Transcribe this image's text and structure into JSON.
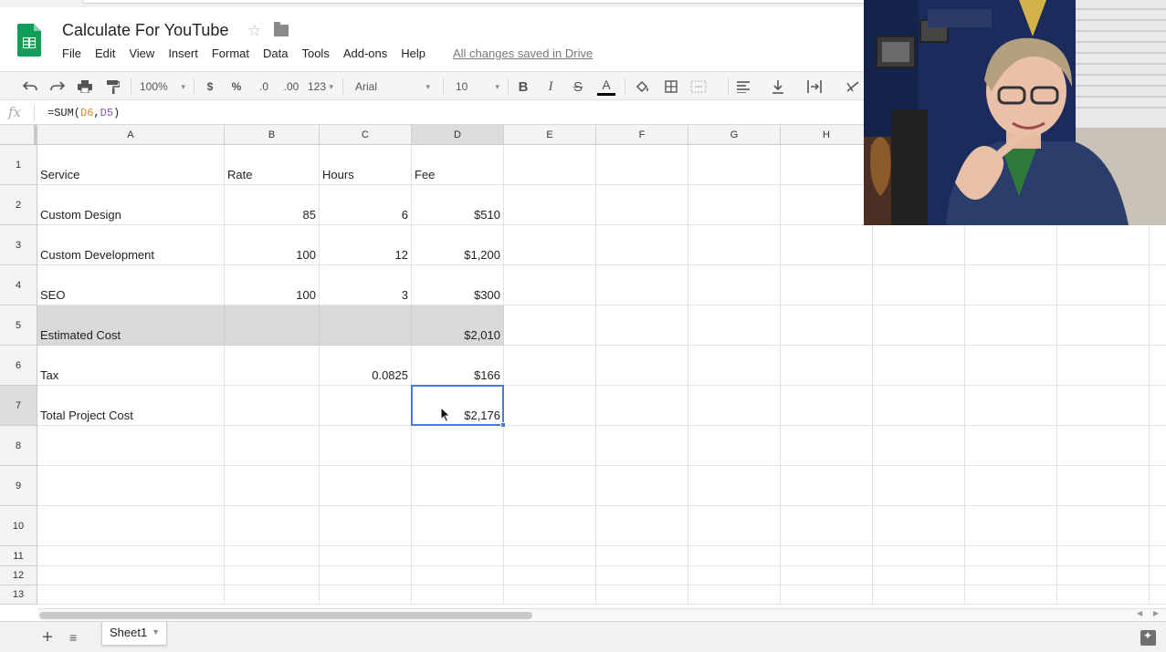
{
  "doc": {
    "title": "Calculate For YouTube",
    "saved_status": "All changes saved in Drive"
  },
  "menu": [
    "File",
    "Edit",
    "View",
    "Insert",
    "Format",
    "Data",
    "Tools",
    "Add-ons",
    "Help"
  ],
  "toolbar": {
    "zoom": "100%",
    "currency": "$",
    "percent": "%",
    "decrease_decimals": ".0",
    "increase_decimals": ".00",
    "more_formats": "123",
    "font": "Arial",
    "font_size": "10",
    "bold": "B",
    "italic": "I",
    "strikethrough": "S",
    "text_color": "A",
    "text_color_hex": "#000000"
  },
  "formula_bar": {
    "fx": "fx",
    "prefix": "=SUM(",
    "ref1": "D6",
    "comma": ",",
    "ref2": "D5",
    "suffix": ")"
  },
  "columns": [
    "A",
    "B",
    "C",
    "D",
    "E",
    "F",
    "G",
    "H",
    "",
    "",
    "",
    ""
  ],
  "rows": [
    "1",
    "2",
    "3",
    "4",
    "5",
    "6",
    "7",
    "8",
    "9",
    "10",
    "11",
    "12",
    "13"
  ],
  "cells": {
    "A1": "Service",
    "B1": "Rate",
    "C1": "Hours",
    "D1": "Fee",
    "A2": "Custom Design",
    "B2": "85",
    "C2": "6",
    "D2": "$510",
    "A3": "Custom Development",
    "B3": "100",
    "C3": "12",
    "D3": "$1,200",
    "A4": "SEO",
    "B4": "100",
    "C4": "3",
    "D4": "$300",
    "A5": "Estimated Cost",
    "D5": "$2,010",
    "C6": "0.0825",
    "A6": "Tax",
    "D6": "$166",
    "A7": "Total Project Cost",
    "D7": "$2,176"
  },
  "selection": {
    "cell": "D7",
    "column": "D",
    "row": "7",
    "color": "#4a7bd6"
  },
  "shaded_row": {
    "row": "5",
    "color": "#d9d9d9"
  },
  "sheetbar": {
    "add_icon": "+",
    "list_icon": "≡",
    "tabs": [
      {
        "label": "Sheet1"
      }
    ]
  },
  "webcam_overlay": {
    "background": "#1a2a55"
  }
}
